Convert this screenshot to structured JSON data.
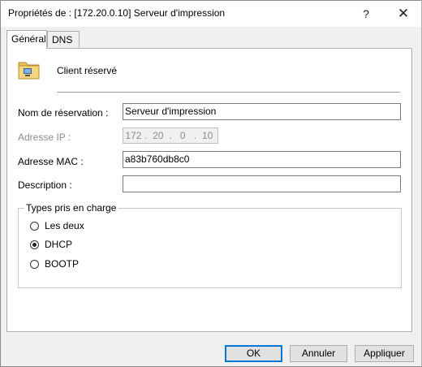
{
  "window": {
    "title": "Propriétés de : [172.20.0.10] Serveur d'impression",
    "help": "?",
    "close": "✕"
  },
  "tabs": [
    {
      "label": "Général",
      "active": true
    },
    {
      "label": "DNS",
      "active": false
    }
  ],
  "client": {
    "label": "Client réservé",
    "icon": "reservation-folder-icon"
  },
  "form": {
    "name_label": "Nom de réservation :",
    "name_value": "Serveur d'impression",
    "ip_label": "Adresse IP :",
    "ip_parts": [
      "172",
      "20",
      "0",
      "10"
    ],
    "mac_label": "Adresse MAC :",
    "mac_value": "a83b760db8c0",
    "desc_label": "Description :",
    "desc_value": ""
  },
  "supported_types": {
    "title": "Types pris en charge",
    "options": [
      {
        "label": "Les deux",
        "checked": false
      },
      {
        "label": "DHCP",
        "checked": true
      },
      {
        "label": "BOOTP",
        "checked": false
      }
    ]
  },
  "buttons": {
    "ok": "OK",
    "cancel": "Annuler",
    "apply": "Appliquer"
  }
}
